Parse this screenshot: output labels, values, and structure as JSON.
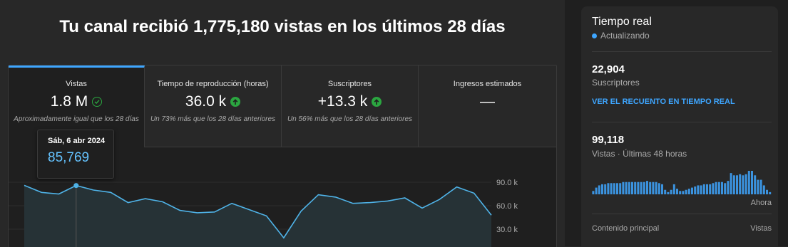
{
  "headline": "Tu canal recibió 1,775,180 vistas en los últimos 28 días",
  "tabs": [
    {
      "label": "Vistas",
      "value": "1.8 M",
      "sub": "Aproximadamente igual que los 28 días",
      "indicator": "check-icon"
    },
    {
      "label": "Tiempo de reproducción (horas)",
      "value": "36.0 k",
      "sub": "Un 73% más que los 28 días anteriores",
      "indicator": "arrow-up-icon"
    },
    {
      "label": "Suscriptores",
      "value": "+13.3 k",
      "sub": "Un 56% más que los 28 días anteriores",
      "indicator": "arrow-up-icon"
    },
    {
      "label": "Ingresos estimados",
      "value": "—",
      "sub": "",
      "indicator": ""
    }
  ],
  "tooltip": {
    "date": "Sáb, 6 abr 2024",
    "value": "85,769"
  },
  "chart_data": {
    "type": "area",
    "series": [
      {
        "values": [
          86000,
          77000,
          75000,
          85769,
          80000,
          77000,
          64000,
          69000,
          65000,
          54000,
          51000,
          52000,
          63000,
          55000,
          47000,
          19000,
          53000,
          74000,
          71000,
          63000,
          64000,
          66000,
          70000,
          57000,
          68000,
          84000,
          76000,
          48000
        ]
      }
    ],
    "yticks": [
      "90.0 k",
      "60.0 k",
      "30.0 k"
    ],
    "ytick_values": [
      90000,
      60000,
      30000
    ],
    "highlight_index": 3,
    "colors": {
      "line": "#4fb3e8",
      "fill": "#263236"
    }
  },
  "realtime": {
    "title": "Tiempo real",
    "status": "Actualizando",
    "subs_value": "22,904",
    "subs_label": "Suscriptores",
    "link": "VER EL RECUENTO EN TIEMPO REAL",
    "views_value": "99,118",
    "views_label": "Vistas · Últimas 48 horas",
    "bars": [
      3,
      6,
      8,
      9,
      9,
      10,
      10,
      10,
      10,
      10,
      11,
      11,
      11,
      11,
      11,
      11,
      11,
      11,
      12,
      11,
      11,
      11,
      10,
      9,
      4,
      2,
      4,
      9,
      5,
      3,
      3,
      4,
      5,
      6,
      7,
      8,
      8,
      9,
      9,
      9,
      10,
      11,
      11,
      11,
      10,
      12,
      19,
      17,
      17,
      18,
      17,
      18,
      21,
      21,
      17,
      13,
      13,
      8,
      4,
      2
    ],
    "now_label": "Ahora",
    "top_content_label": "Contenido principal",
    "top_content_metric": "Vistas"
  }
}
